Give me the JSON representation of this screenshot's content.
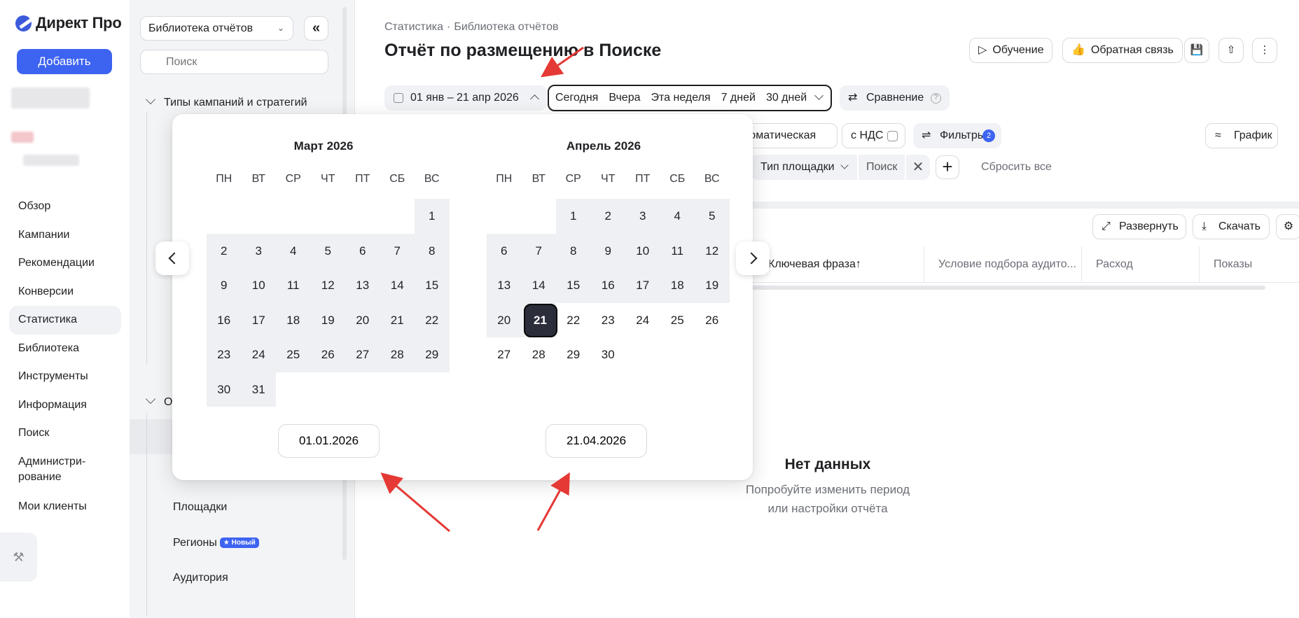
{
  "app": {
    "logo_text": "Директ Про",
    "add_button": "Добавить",
    "nav": [
      {
        "label": "Обзор"
      },
      {
        "label": "Кампании"
      },
      {
        "label": "Рекомендации"
      },
      {
        "label": "Конверсии"
      },
      {
        "label": "Статистика",
        "active": true
      },
      {
        "label": "Библиотека"
      },
      {
        "label": "Инструменты"
      },
      {
        "label": "Информация"
      },
      {
        "label": "Поиск"
      },
      {
        "label": "Администри-рование"
      },
      {
        "label": "Мои клиенты"
      }
    ]
  },
  "library": {
    "select_value": "Библиотека отчётов",
    "search_placeholder": "Поиск",
    "group1": "Типы кампаний и стратегий",
    "group2": "О",
    "items": [
      "Площадки",
      "Регионы",
      "Аудитория"
    ],
    "new_badge": "★ Новый"
  },
  "header": {
    "breadcrumb": [
      "Статистика",
      "Библиотека отчётов"
    ],
    "title": "Отчёт по размещению в Поиске",
    "buttons": {
      "training": "Обучение",
      "feedback": "Обратная связь"
    }
  },
  "toolbar": {
    "date_range": "01 янв – 21 апр 2026",
    "presets": [
      "Сегодня",
      "Вчера",
      "Эта неделя",
      "7 дней",
      "30 дней"
    ],
    "compare": "Сравнение",
    "attribution": "втоматическая",
    "vat": "с НДС",
    "filters": "Фильтры",
    "filters_count": "2",
    "chart": "График",
    "filter_chip_field": "Тип площадки",
    "filter_chip_value": "Поиск",
    "reset_all": "Сбросить все"
  },
  "table": {
    "expand": "Развернуть",
    "download": "Скачать",
    "columns": [
      "Ключевая фраза↑",
      "Условие подбора аудито...",
      "Расход",
      "Показы"
    ],
    "empty_title": "Нет данных",
    "empty_text_1": "Попробуйте изменить период",
    "empty_text_2": "или настройки отчёта"
  },
  "calendar": {
    "weekdays": [
      "ПН",
      "ВТ",
      "СР",
      "ЧТ",
      "ПТ",
      "СБ",
      "ВС"
    ],
    "months": [
      {
        "title": "Март 2026",
        "first_weekday": 6,
        "days": 31,
        "in_range_from": 1,
        "in_range_to": 31
      },
      {
        "title": "Апрель 2026",
        "first_weekday": 2,
        "days": 30,
        "in_range_from": 1,
        "in_range_to": 21,
        "selected": 21
      }
    ],
    "start_input": "01.01.2026",
    "end_input": "21.04.2026"
  }
}
